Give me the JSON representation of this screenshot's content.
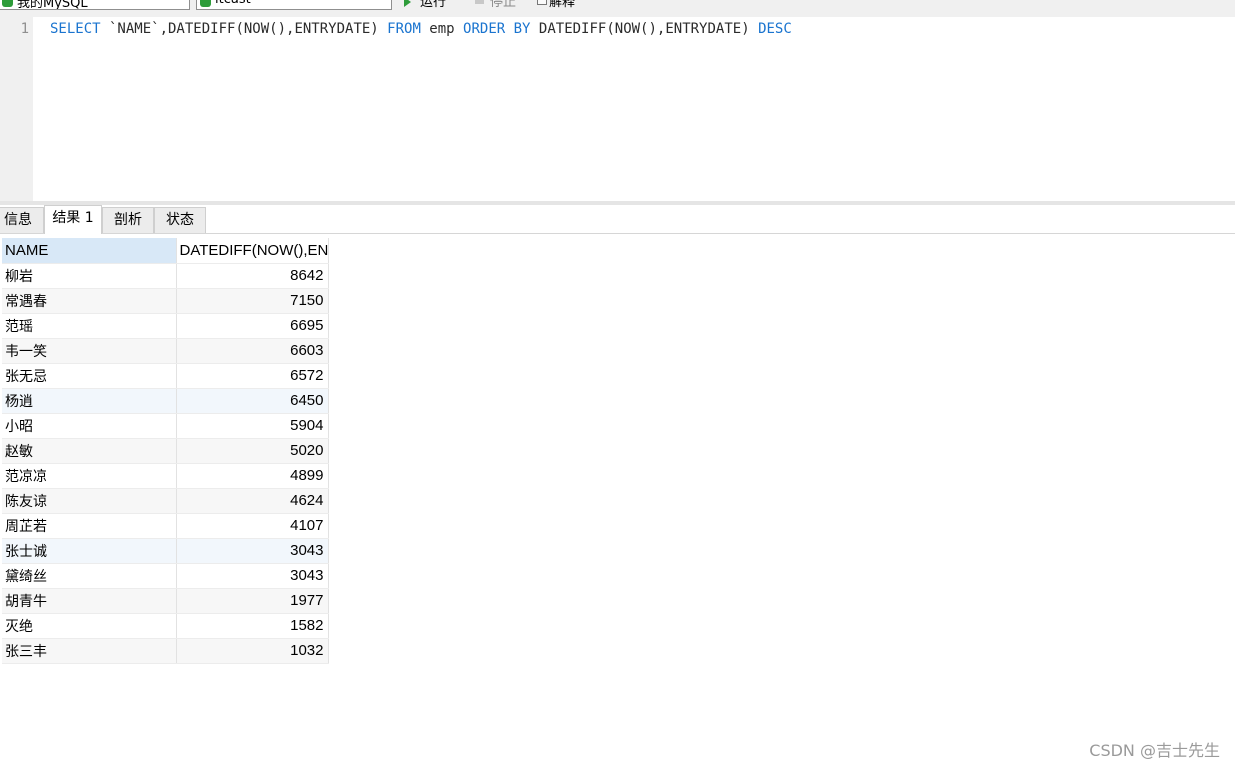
{
  "toolbar": {
    "connection": "我的MySQL",
    "database": "itcast",
    "run_label": "运行",
    "stop_label": "停止",
    "explain_label": "解释"
  },
  "editor": {
    "line_number": "1",
    "query": {
      "select_kw": "SELECT",
      "select_list": " `NAME`,DATEDIFF(NOW(),ENTRYDATE) ",
      "from_kw": "FROM",
      "table": " emp ",
      "order_kw": "ORDER",
      "by_kw": "BY",
      "order_expr": " DATEDIFF(NOW(),ENTRYDATE) ",
      "desc_kw": "DESC"
    }
  },
  "tabs": [
    "信息",
    "结果 1",
    "剖析",
    "状态"
  ],
  "grid": {
    "columns": [
      "NAME",
      "DATEDIFF(NOW(),EN"
    ],
    "rows": [
      {
        "name": "柳岩",
        "value": "8642"
      },
      {
        "name": "常遇春",
        "value": "7150"
      },
      {
        "name": "范瑶",
        "value": "6695"
      },
      {
        "name": "韦一笑",
        "value": "6603"
      },
      {
        "name": "张无忌",
        "value": "6572"
      },
      {
        "name": "杨逍",
        "value": "6450"
      },
      {
        "name": "小昭",
        "value": "5904"
      },
      {
        "name": "赵敏",
        "value": "5020"
      },
      {
        "name": "范凉凉",
        "value": "4899"
      },
      {
        "name": "陈友谅",
        "value": "4624"
      },
      {
        "name": "周芷若",
        "value": "4107"
      },
      {
        "name": "张士诚",
        "value": "3043"
      },
      {
        "name": "黛绮丝",
        "value": "3043"
      },
      {
        "name": "胡青牛",
        "value": "1977"
      },
      {
        "name": "灭绝",
        "value": "1582"
      },
      {
        "name": "张三丰",
        "value": "1032"
      }
    ]
  },
  "watermark": "CSDN @吉士先生",
  "colors": {
    "keyword": "#1a74cf",
    "header_highlight": "#d8e8f7",
    "db_icon": "#2e9c3a"
  }
}
